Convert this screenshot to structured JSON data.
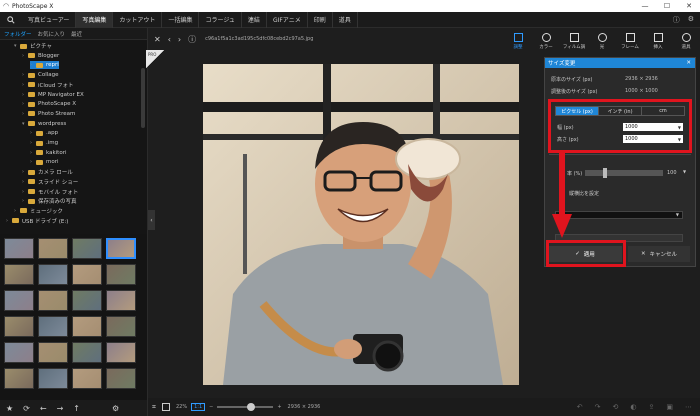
{
  "app": {
    "title": "PhotoScape X"
  },
  "menu": {
    "items": [
      "写真ビューアー",
      "写真編集",
      "カットアウト",
      "一括編集",
      "コラージュ",
      "連結",
      "GIFアニメ",
      "印刷",
      "道具"
    ],
    "active_index": 1
  },
  "tree": {
    "tabs": [
      "フォルダー",
      "お気に入り",
      "最近"
    ],
    "rows": [
      {
        "label": "ピクチャ",
        "indent": 1,
        "open": true
      },
      {
        "label": "Blogger",
        "indent": 2
      },
      {
        "label": "repri",
        "indent": 3,
        "selected": true
      },
      {
        "label": "Collage",
        "indent": 2
      },
      {
        "label": "iCloud フォト",
        "indent": 2
      },
      {
        "label": "MP Navigator EX",
        "indent": 2
      },
      {
        "label": "PhotoScape X",
        "indent": 2
      },
      {
        "label": "Photo Stream",
        "indent": 2
      },
      {
        "label": "wordpress",
        "indent": 2,
        "open": true
      },
      {
        "label": ".app",
        "indent": 3
      },
      {
        "label": ".img",
        "indent": 3
      },
      {
        "label": "kakitori",
        "indent": 3
      },
      {
        "label": "mori",
        "indent": 3
      },
      {
        "label": "カメラ ロール",
        "indent": 2
      },
      {
        "label": "スライド ショー",
        "indent": 2
      },
      {
        "label": "モバイル フォト",
        "indent": 2
      },
      {
        "label": "保存済みの写真",
        "indent": 2
      },
      {
        "label": "ミュージック",
        "indent": 1
      },
      {
        "label": "USB ドライブ (E:)",
        "indent": 0
      }
    ]
  },
  "nav": {
    "filename": "c96a1f5a1c3ad195c5dfc08cebd2c97a5.jpg"
  },
  "toolbar": {
    "buttons": [
      {
        "label": "調整",
        "icon": "edit-icon",
        "active": true
      },
      {
        "label": "カラー",
        "icon": "color-icon"
      },
      {
        "label": "フィルム調",
        "icon": "film-icon"
      },
      {
        "label": "光",
        "icon": "light-icon"
      },
      {
        "label": "フレーム",
        "icon": "frame-icon"
      },
      {
        "label": "挿入",
        "icon": "insert-icon"
      },
      {
        "label": "道具",
        "icon": "tools-icon"
      }
    ]
  },
  "resize_panel": {
    "title": "サイズ変更",
    "original_label": "原本のサイズ (px)",
    "original_value": "2936 × 2936",
    "adjusted_label": "調整後のサイズ (px)",
    "adjusted_value": "1000 × 1000",
    "unit_tabs": [
      "ピクセル (px)",
      "インチ (in)",
      "cm"
    ],
    "active_unit": 0,
    "width_label": "幅 (px)",
    "width_value": "1000",
    "height_label": "高さ (px)",
    "height_value": "1000",
    "quality_label": "率 (%)",
    "quality_value": "100",
    "advanced_label": "縦横比を設定",
    "apply_label": "適用",
    "cancel_label": "キャンセル"
  },
  "bottom": {
    "zoom": "22%",
    "zoom_fit": "1:1",
    "size": "2936 × 2936"
  },
  "colors": {
    "accent": "#1f86d6",
    "highlight": "#e0141e"
  }
}
